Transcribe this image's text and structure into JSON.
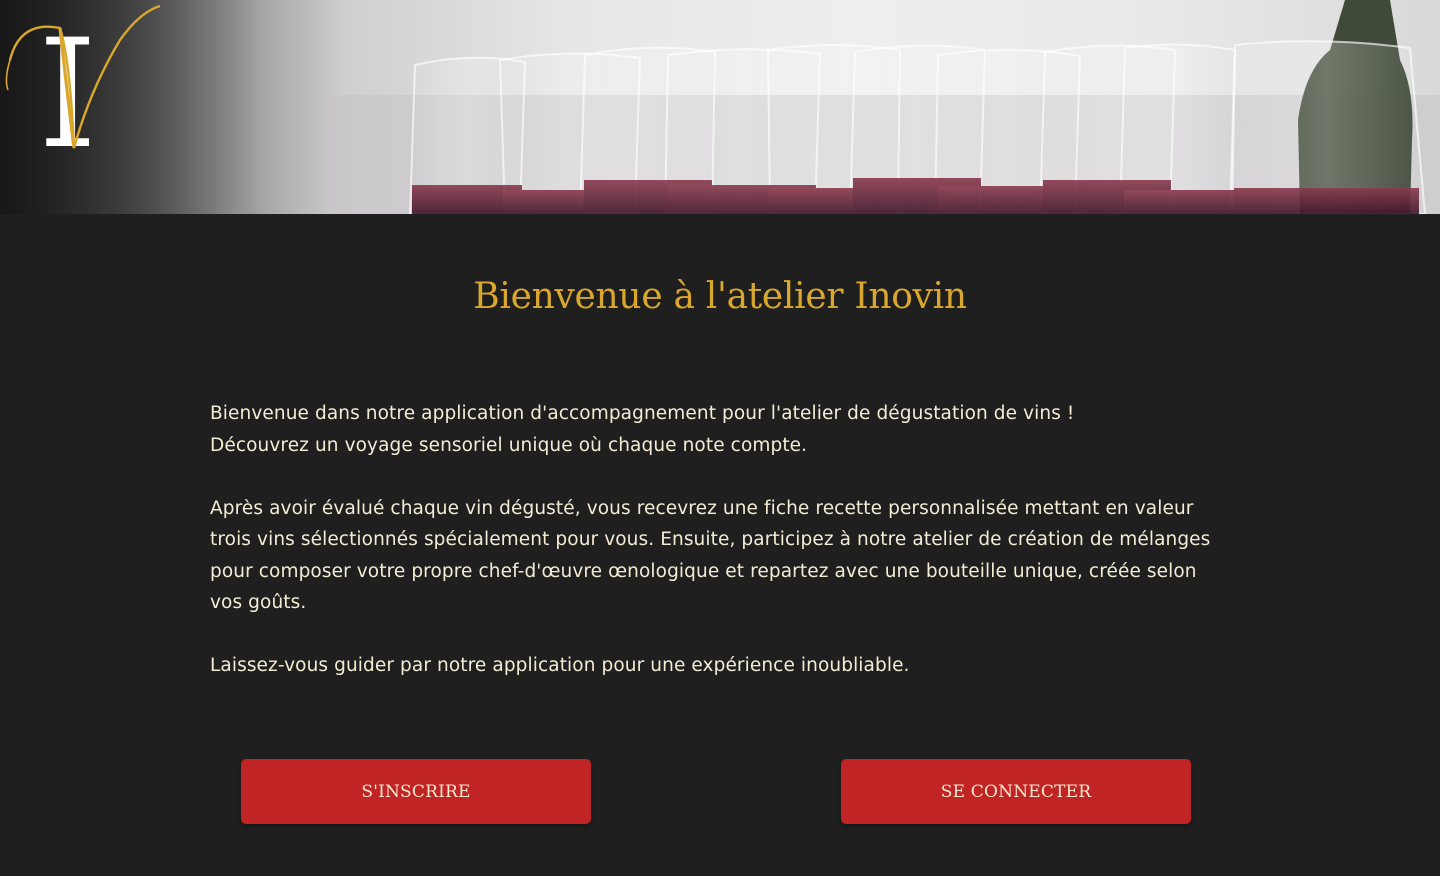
{
  "header": {
    "logo_letters": "IV",
    "banner_image": "wine-glasses-photo"
  },
  "main": {
    "title": "Bienvenue à l'atelier Inovin",
    "intro": {
      "line1": "Bienvenue dans notre application d'accompagnement pour l'atelier de dégustation de vins !",
      "line2": "Découvrez un voyage sensoriel unique où chaque note compte.",
      "paragraph2": "Après avoir évalué chaque vin dégusté, vous recevrez une fiche recette personnalisée mettant en valeur trois vins sélectionnés spécialement pour vous. Ensuite, participez à notre atelier de création de mélanges pour composer votre propre chef-d'œuvre œnologique et repartez avec une bouteille unique, créée selon vos goûts.",
      "paragraph3": "Laissez-vous guider par notre application pour une expérience inoubliable."
    },
    "buttons": {
      "signup_label": "S'INSCRIRE",
      "login_label": "SE CONNECTER"
    }
  },
  "colors": {
    "background": "#1f1f1f",
    "accent_gold": "#d9a72c",
    "button_red": "#c02424",
    "text_cream": "#f4ecd4"
  }
}
